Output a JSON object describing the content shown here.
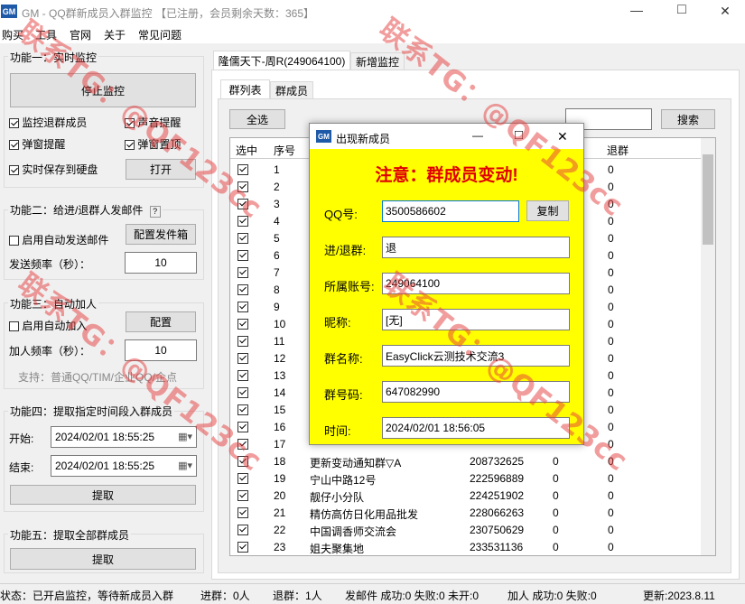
{
  "window": {
    "icon_text": "GM",
    "title": "GM - QQ群新成员入群监控 【已注册，会员剩余天数：365】",
    "minimize": "—",
    "maximize": "□",
    "close": "✕"
  },
  "menu": [
    "购买",
    "工具",
    "官网",
    "关于",
    "常见问题"
  ],
  "func1": {
    "title": "功能一：实时监控",
    "stop_button": "停止监控",
    "checks": [
      {
        "label": "监控退群成员",
        "checked": true
      },
      {
        "label": "声音提醒",
        "checked": true
      },
      {
        "label": "弹窗提醒",
        "checked": true
      },
      {
        "label": "弹窗置顶",
        "checked": true
      },
      {
        "label": "实时保存到硬盘",
        "checked": true
      }
    ],
    "open_button": "打开"
  },
  "func2": {
    "title": "功能二：给进/退群人发邮件",
    "help": "?",
    "auto_mail_label": "启用自动发送邮件",
    "config_mail_button": "配置发件箱",
    "freq_label": "发送频率（秒）：",
    "freq_value": "10"
  },
  "func3": {
    "title": "功能三：自动加人",
    "auto_add_label": "启用自动加入",
    "config_button": "配置",
    "freq_label": "加人频率（秒）：",
    "freq_value": "10",
    "support": "支持：普通QQ/TIM/企业QQ/企点"
  },
  "func4": {
    "title": "功能四：提取指定时间段入群成员",
    "start_label": "开始:",
    "start_value": "2024/02/01 18:55:25",
    "end_label": "结束:",
    "end_value": "2024/02/01 18:55:25",
    "extract_button": "提取"
  },
  "func5": {
    "title": "功能五：提取全部群成员",
    "extract_button": "提取"
  },
  "tabs_top": [
    "隆儒天下-周R(249064100)",
    "新增监控"
  ],
  "tabs_inner": [
    "群列表",
    "群成员"
  ],
  "select_all_button": "全选",
  "search_value": "",
  "search_button": "搜索",
  "grid": {
    "headers": [
      "选中",
      "序号",
      "",
      "",
      "",
      "退群"
    ],
    "rows": [
      {
        "no": "1",
        "name": "",
        "id": "",
        "a": "",
        "b": "0"
      },
      {
        "no": "2",
        "name": "",
        "id": "",
        "a": "",
        "b": "0"
      },
      {
        "no": "3",
        "name": "",
        "id": "",
        "a": "",
        "b": "0"
      },
      {
        "no": "4",
        "name": "",
        "id": "",
        "a": "",
        "b": "0"
      },
      {
        "no": "5",
        "name": "",
        "id": "",
        "a": "",
        "b": "0"
      },
      {
        "no": "6",
        "name": "",
        "id": "",
        "a": "",
        "b": "0"
      },
      {
        "no": "7",
        "name": "",
        "id": "",
        "a": "",
        "b": "0"
      },
      {
        "no": "8",
        "name": "",
        "id": "",
        "a": "",
        "b": "0"
      },
      {
        "no": "9",
        "name": "",
        "id": "",
        "a": "",
        "b": "0"
      },
      {
        "no": "10",
        "name": "",
        "id": "",
        "a": "",
        "b": "0"
      },
      {
        "no": "11",
        "name": "",
        "id": "",
        "a": "",
        "b": "0"
      },
      {
        "no": "12",
        "name": "",
        "id": "",
        "a": "",
        "b": "0"
      },
      {
        "no": "13",
        "name": "",
        "id": "",
        "a": "",
        "b": "0"
      },
      {
        "no": "14",
        "name": "",
        "id": "",
        "a": "",
        "b": "0"
      },
      {
        "no": "15",
        "name": "",
        "id": "",
        "a": "",
        "b": "0"
      },
      {
        "no": "16",
        "name": "",
        "id": "",
        "a": "",
        "b": "0"
      },
      {
        "no": "17",
        "name": "",
        "id": "",
        "a": "",
        "b": "0"
      },
      {
        "no": "18",
        "name": "更新变动通知群▽A",
        "id": "208732625",
        "a": "0",
        "b": "0"
      },
      {
        "no": "19",
        "name": "宁山中路12号",
        "id": "222596889",
        "a": "0",
        "b": "0"
      },
      {
        "no": "20",
        "name": "靓仔小分队",
        "id": "224251902",
        "a": "0",
        "b": "0"
      },
      {
        "no": "21",
        "name": "精仿高仿日化用品批发",
        "id": "228066263",
        "a": "0",
        "b": "0"
      },
      {
        "no": "22",
        "name": "中国调香师交流会",
        "id": "230750629",
        "a": "0",
        "b": "0"
      },
      {
        "no": "23",
        "name": "姐夫聚集地",
        "id": "233531136",
        "a": "0",
        "b": "0"
      }
    ]
  },
  "dialog": {
    "icon_text": "GM",
    "title": "出现新成员",
    "minimize": "—",
    "maximize": "□",
    "close": "✕",
    "heading": "注意：群成员变动!",
    "copy_button": "复制",
    "fields": [
      {
        "label": "QQ号:",
        "value": "3500586602"
      },
      {
        "label": "进/退群:",
        "value": "退"
      },
      {
        "label": "所属账号:",
        "value": "249064100"
      },
      {
        "label": "昵称:",
        "value": "[无]"
      },
      {
        "label": "群名称:",
        "value": "EasyClick云测技术交流3"
      },
      {
        "label": "群号码:",
        "value": "647082990"
      },
      {
        "label": "时间:",
        "value": "2024/02/01 18:56:05"
      }
    ]
  },
  "status": {
    "state": "状态：已开启监控，等待新成员入群",
    "join": "进群：0人",
    "quit": "退群：1人",
    "mail": "发邮件 成功:0 失败:0 未开:0",
    "add": "加人 成功:0 失败:0",
    "update": "更新:2023.8.11"
  },
  "watermarks": [
    "联系TG：@QF123cc",
    "联系TG：@QF123cc",
    "联系TG：@QF123cc",
    "联系TG：@QF123cc"
  ],
  "colors": {
    "dialog_bg": "#ffff00",
    "heading": "#e00000",
    "accent": "#0078d7"
  }
}
